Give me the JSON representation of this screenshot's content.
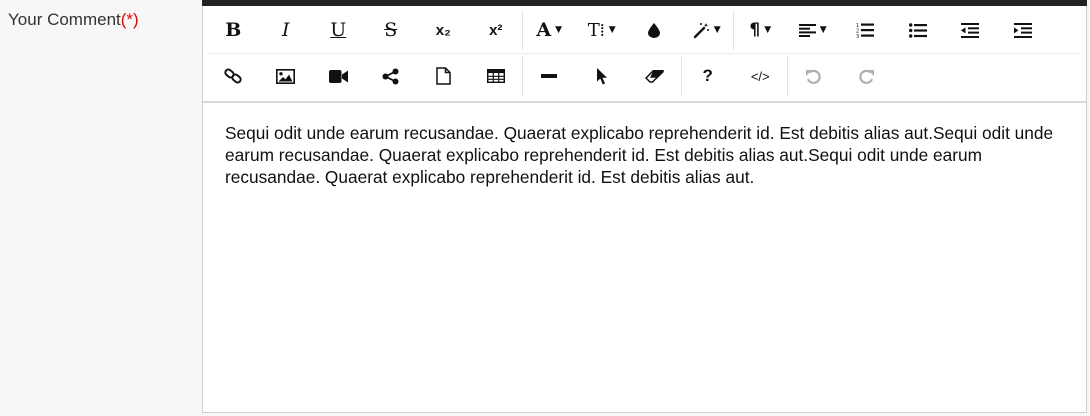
{
  "form": {
    "label": "Your Comment",
    "required_marker": "(*)",
    "required_color": "#e00000"
  },
  "editor": {
    "content": "Sequi odit unde earum recusandae. Quaerat explicabo reprehenderit id. Est debitis alias aut.Sequi odit unde earum recusandae. Quaerat explicabo reprehenderit id. Est debitis alias aut.Sequi odit unde earum recusandae. Quaerat explicabo reprehenderit id. Est debitis alias aut.",
    "toolbar_accent": "#222222"
  },
  "toolbar": {
    "bold": "B",
    "italic": "I",
    "underline": "U",
    "strikethrough": "S",
    "subscript": "x₂",
    "superscript": "x²",
    "font_color": "A",
    "font_size": "T⁞",
    "paragraph": "¶",
    "help": "?",
    "code_view": "</>",
    "icons": {
      "background_color": "drop-icon",
      "magic": "magic-wand-icon",
      "align": "align-left-icon",
      "ordered_list": "ordered-list-icon",
      "unordered_list": "unordered-list-icon",
      "outdent": "outdent-icon",
      "indent": "indent-icon",
      "link": "link-icon",
      "image": "image-icon",
      "video": "video-icon",
      "share": "share-icon",
      "file": "file-icon",
      "table": "table-icon",
      "horizontal_rule": "minus-icon",
      "cursor": "cursor-icon",
      "eraser": "eraser-icon",
      "undo": "undo-icon",
      "redo": "redo-icon"
    }
  }
}
